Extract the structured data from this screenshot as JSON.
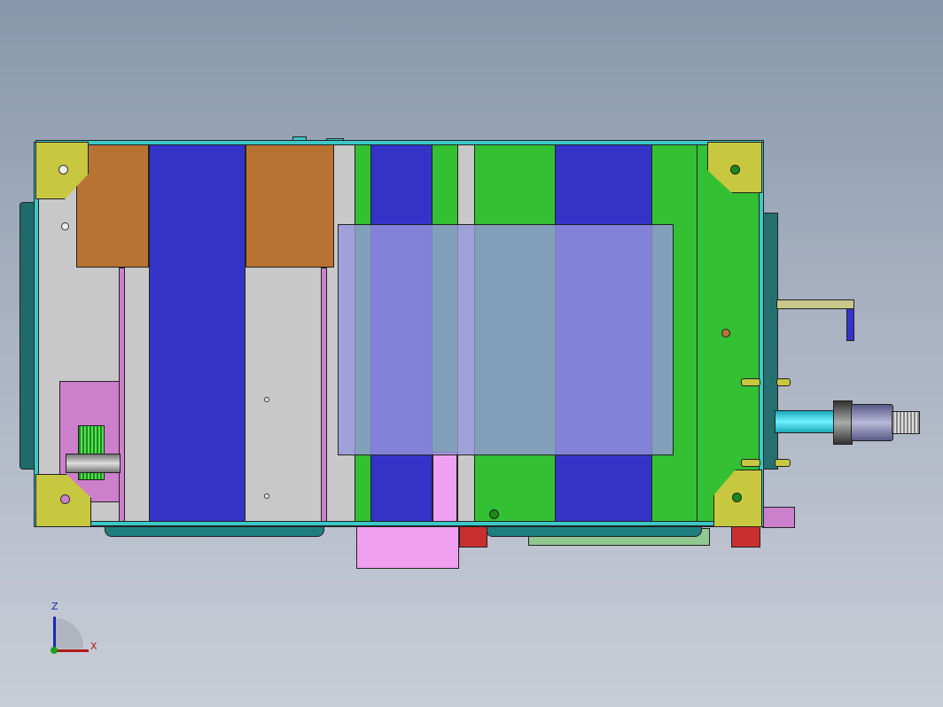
{
  "viewport": {
    "colors": {
      "frame": "#c8c8c8",
      "cyan": "#3cc8c8",
      "yellow": "#c8c840",
      "brown": "#b87333",
      "blue": "#3333c8",
      "green": "#33c033",
      "translucent_purple": "#7f7fc8",
      "pink": "#cc80cc",
      "light_pink": "#f0a0f0",
      "red": "#c83030"
    }
  },
  "triad": {
    "z_label": "Z",
    "x_label": "X"
  }
}
